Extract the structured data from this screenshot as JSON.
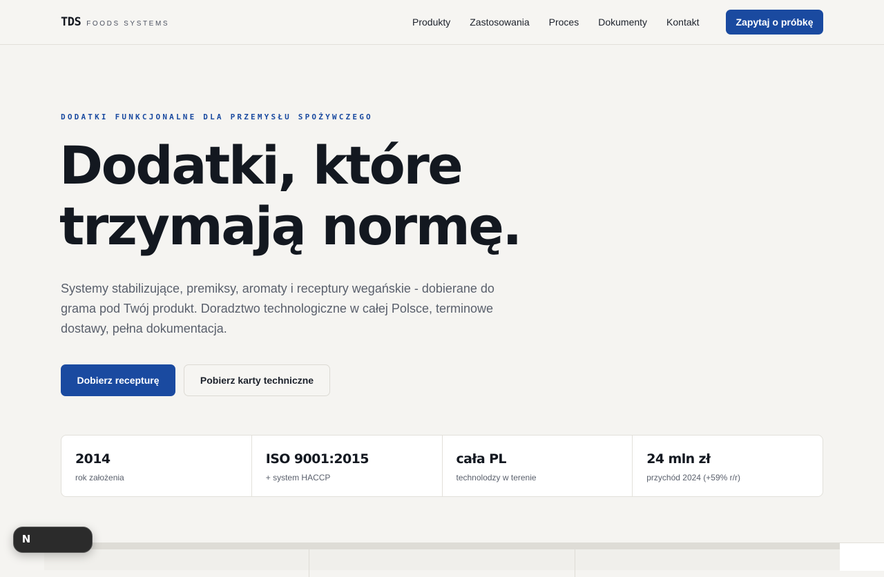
{
  "header": {
    "logo_mark": "TDS",
    "logo_sub": "FOODS SYSTEMS",
    "nav": [
      "Produkty",
      "Zastosowania",
      "Proces",
      "Dokumenty",
      "Kontakt"
    ],
    "cta_label": "Zapytaj o próbkę"
  },
  "hero": {
    "eyebrow": "DODATKI FUNKCJONALNE DLA PRZEMYSŁU SPOŻYWCZEGO",
    "headline_line1": "Dodatki, które",
    "headline_line2": "trzymają normę.",
    "lead": "Systemy stabilizujące, premiksy, aromaty i receptury wegańskie - dobierane do grama pod Twój produkt. Doradztwo technologiczne w całej Polsce, terminowe dostawy, pełna dokumentacja.",
    "primary_button": "Dobierz recepturę",
    "secondary_button": "Pobierz karty techniczne"
  },
  "stats": [
    {
      "value": "2014",
      "label": "rok założenia"
    },
    {
      "value": "ISO 9001:2015",
      "label": "+ system HACCP"
    },
    {
      "value": "cała PL",
      "label": "technolodzy w terenie"
    },
    {
      "value": "24 mln zł",
      "label": "przychód 2024 (+59% r/r)"
    }
  ],
  "dev_badge": {
    "icon": "next-logo-icon",
    "glyph": "N"
  },
  "colors": {
    "accent": "#1a4aa0",
    "background": "#f5f4f1",
    "text": "#131820"
  }
}
